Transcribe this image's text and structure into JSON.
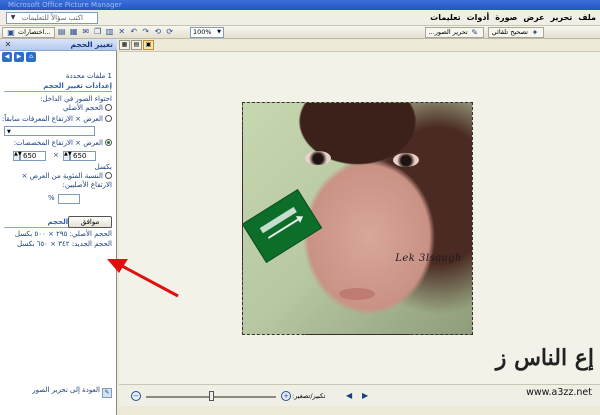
{
  "window": {
    "title": "Microsoft Office Picture Manager"
  },
  "menu": {
    "items": [
      "ملف",
      "تحرير",
      "عرض",
      "صورة",
      "أدوات",
      "تعليمات"
    ],
    "ask_placeholder": "اكتب سؤالاً للتعليمات"
  },
  "toolbar": {
    "shortcuts_label": "اختصارات...",
    "zoom_value": "100%",
    "edit_pictures_label": "تحرير الصور...",
    "auto_correct_label": "تصحيح تلقائي"
  },
  "taskpane": {
    "title": "تغيير الحجم",
    "files_selected": "1 ملفات محددة",
    "settings_heading": "إعدادات تغيير الحجم",
    "fit_label": "احتواء الصور في الداخل:",
    "option_original": "الحجم الأصلي",
    "option_predefined": "العرض × الارتفاع المعرفات سابقاً:",
    "option_custom": "العرض × الارتفاع المخصصات:",
    "width_value": "650",
    "height_value": "650",
    "times_sign": "×",
    "pixels_unit": "بكسل",
    "option_percent": "النسبة المئوية من العرض × الارتفاع الأصليين:",
    "percent_sign": "%",
    "summary_heading": "ملخص إعداد الحجم",
    "original_size": "الحجم الأصلي: ٢٩٥ × ٥٠٠ بكسل",
    "new_size": "الحجم الجديد: ٣٤٢ × ٦٥٠ بكسل",
    "ok_label": "موافق",
    "back_link": "العودة إلى تحرير الصور"
  },
  "photo": {
    "signature": "Lek 3lsaagh"
  },
  "statusbar": {
    "zoom_label": "تكبير/تصغير:"
  },
  "watermark": {
    "title": "إع الناس ز",
    "url": "www.a3zz.net"
  }
}
